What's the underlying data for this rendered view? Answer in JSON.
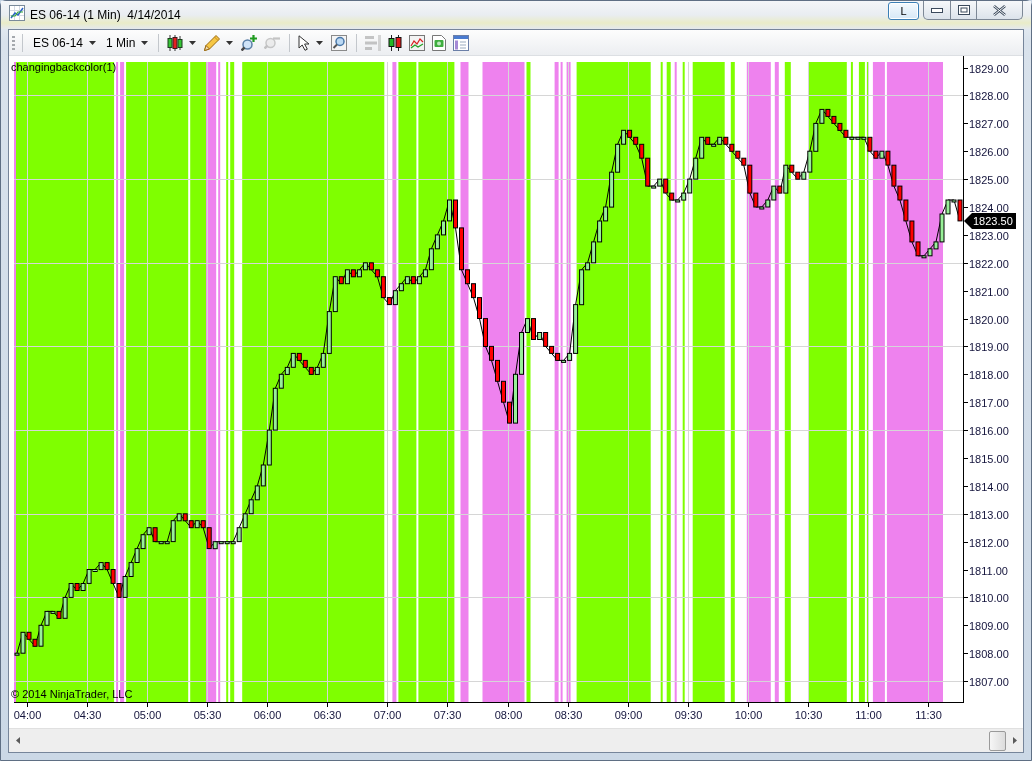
{
  "window": {
    "title": "ES 06-14 (1 Min)  4/14/2014",
    "buttons": [
      "L"
    ]
  },
  "toolbar": {
    "groups": [
      [
        {
          "kind": "select",
          "label": "ES 06-14",
          "disabled": false
        },
        {
          "kind": "select",
          "label": "1 Min",
          "disabled": false
        }
      ],
      [
        {
          "kind": "candles",
          "disabled": false
        },
        {
          "kind": "arrow",
          "disabled": false
        },
        {
          "kind": "pencil",
          "disabled": false
        },
        {
          "kind": "arrow",
          "disabled": false
        },
        {
          "kind": "zoomin",
          "disabled": false
        },
        {
          "kind": "zoomout",
          "disabled": true
        }
      ],
      [
        {
          "kind": "pointer",
          "disabled": false
        },
        {
          "kind": "arrow",
          "disabled": false
        },
        {
          "kind": "magnifier",
          "disabled": false
        }
      ],
      [
        {
          "kind": "rows",
          "disabled": true
        },
        {
          "kind": "candlebox",
          "disabled": false
        },
        {
          "kind": "linechart",
          "disabled": false
        },
        {
          "kind": "banknote",
          "disabled": false
        },
        {
          "kind": "layout",
          "disabled": false
        }
      ]
    ]
  },
  "chart": {
    "indicator_label": "changingbackcolor(1)",
    "copyright": "© 2014 NinjaTrader, LLC",
    "last_price": "1823.50",
    "chart_data": {
      "type": "line",
      "grid": true,
      "x": [
        235,
        238,
        241,
        244,
        247,
        250,
        253,
        256,
        259,
        262,
        265,
        268,
        271,
        274,
        277,
        280,
        283,
        286,
        289,
        292,
        295,
        298,
        301,
        304,
        307,
        310,
        313,
        316,
        319,
        322,
        325,
        328,
        331,
        334,
        337,
        340,
        343,
        346,
        349,
        352,
        355,
        358,
        361,
        364,
        367,
        370,
        373,
        376,
        379,
        382,
        385,
        388,
        391,
        394,
        397,
        400,
        403,
        406,
        409,
        412,
        415,
        418,
        421,
        424,
        427,
        430,
        433,
        436,
        439,
        442,
        445,
        448,
        451,
        454,
        457,
        460,
        463,
        466,
        469,
        472,
        475,
        478,
        481,
        484,
        487,
        490,
        493,
        496,
        499,
        502,
        505,
        508,
        511,
        514,
        517,
        520,
        523,
        526,
        529,
        532,
        535,
        538,
        541,
        544,
        547,
        550,
        553,
        556,
        559,
        562,
        565,
        568,
        571,
        574,
        577,
        580,
        583,
        586,
        589,
        592,
        595,
        598,
        601,
        604,
        607,
        610,
        613,
        616,
        619,
        622,
        625,
        628,
        631,
        634,
        637,
        640,
        643,
        646,
        649,
        652,
        655,
        658,
        661,
        664,
        667,
        670,
        673,
        676,
        679,
        682,
        685,
        688,
        691,
        694,
        697,
        700,
        703,
        706
      ],
      "values": [
        1808.0,
        1808.75,
        1808.5,
        1808.25,
        1809.0,
        1809.5,
        1809.5,
        1809.25,
        1810.0,
        1810.5,
        1810.25,
        1810.5,
        1811.0,
        1811.0,
        1811.25,
        1811.0,
        1810.5,
        1810.0,
        1810.75,
        1811.25,
        1811.75,
        1812.25,
        1812.5,
        1812.0,
        1812.0,
        1812.0,
        1812.75,
        1813.0,
        1812.75,
        1812.5,
        1812.75,
        1812.5,
        1811.75,
        1812.0,
        1812.0,
        1812.0,
        1812.0,
        1812.5,
        1813.0,
        1813.5,
        1814.0,
        1814.75,
        1816.0,
        1817.5,
        1818.0,
        1818.25,
        1818.75,
        1818.5,
        1818.25,
        1818.0,
        1818.25,
        1818.75,
        1820.25,
        1821.5,
        1821.25,
        1821.75,
        1821.5,
        1821.75,
        1822.0,
        1821.75,
        1821.5,
        1820.75,
        1820.5,
        1821.0,
        1821.25,
        1821.5,
        1821.25,
        1821.5,
        1821.75,
        1822.5,
        1823.0,
        1823.5,
        1824.25,
        1823.25,
        1821.75,
        1821.25,
        1820.75,
        1820.0,
        1819.0,
        1818.5,
        1817.75,
        1817.0,
        1816.25,
        1818.0,
        1819.5,
        1820.0,
        1819.25,
        1819.5,
        1819.0,
        1818.75,
        1818.5,
        1818.5,
        1818.75,
        1820.5,
        1821.75,
        1822.0,
        1822.75,
        1823.5,
        1824.0,
        1825.25,
        1826.25,
        1826.75,
        1826.5,
        1826.25,
        1825.75,
        1824.75,
        1824.75,
        1825.0,
        1824.5,
        1824.25,
        1824.25,
        1824.5,
        1825.0,
        1825.75,
        1826.5,
        1826.25,
        1826.25,
        1826.5,
        1826.25,
        1826.0,
        1825.75,
        1825.5,
        1824.5,
        1824.0,
        1824.0,
        1824.25,
        1824.75,
        1824.5,
        1825.5,
        1825.25,
        1825.0,
        1825.25,
        1826.0,
        1827.0,
        1827.5,
        1827.25,
        1827.0,
        1826.75,
        1826.5,
        1826.5,
        1826.5,
        1826.5,
        1826.0,
        1825.75,
        1826.0,
        1825.5,
        1824.75,
        1824.25,
        1823.5,
        1822.75,
        1822.25,
        1822.25,
        1822.5,
        1822.75,
        1823.75,
        1824.25,
        1824.25,
        1823.5
      ],
      "xlim": [
        233.5,
        707.5
      ],
      "ylim": [
        1806.25,
        1829.2
      ],
      "xticks": [
        {
          "value": 240,
          "label": "04:00"
        },
        {
          "value": 270,
          "label": "04:30"
        },
        {
          "value": 300,
          "label": "05:00"
        },
        {
          "value": 330,
          "label": "05:30"
        },
        {
          "value": 360,
          "label": "06:00"
        },
        {
          "value": 390,
          "label": "06:30"
        },
        {
          "value": 420,
          "label": "07:00"
        },
        {
          "value": 450,
          "label": "07:30"
        },
        {
          "value": 480,
          "label": "08:00"
        },
        {
          "value": 510,
          "label": "08:30"
        },
        {
          "value": 540,
          "label": "09:00"
        },
        {
          "value": 570,
          "label": "09:30"
        },
        {
          "value": 600,
          "label": "10:00"
        },
        {
          "value": 630,
          "label": "10:30"
        },
        {
          "value": 660,
          "label": "11:00"
        },
        {
          "value": 690,
          "label": "11:30"
        }
      ],
      "yticks": [
        {
          "value": 1807,
          "label": "1807.00"
        },
        {
          "value": 1808,
          "label": "1808.00"
        },
        {
          "value": 1809,
          "label": "1809.00"
        },
        {
          "value": 1810,
          "label": "1810.00"
        },
        {
          "value": 1811,
          "label": "1811.00"
        },
        {
          "value": 1812,
          "label": "1812.00"
        },
        {
          "value": 1813,
          "label": "1813.00"
        },
        {
          "value": 1814,
          "label": "1814.00"
        },
        {
          "value": 1815,
          "label": "1815.00"
        },
        {
          "value": 1816,
          "label": "1816.00"
        },
        {
          "value": 1817,
          "label": "1817.00"
        },
        {
          "value": 1818,
          "label": "1818.00"
        },
        {
          "value": 1819,
          "label": "1819.00"
        },
        {
          "value": 1820,
          "label": "1820.00"
        },
        {
          "value": 1821,
          "label": "1821.00"
        },
        {
          "value": 1822,
          "label": "1822.00"
        },
        {
          "value": 1823,
          "label": "1823.00"
        },
        {
          "value": 1824,
          "label": "1824.00"
        },
        {
          "value": 1825,
          "label": "1825.00"
        },
        {
          "value": 1826,
          "label": "1826.00"
        },
        {
          "value": 1827,
          "label": "1827.00"
        },
        {
          "value": 1828,
          "label": "1828.00"
        },
        {
          "value": 1829,
          "label": "1829.00"
        }
      ],
      "bands": [
        {
          "axis": "x",
          "from": 233.5,
          "to": 234.5,
          "color": "#ee82ee"
        },
        {
          "axis": "x",
          "from": 234.5,
          "to": 283.5,
          "color": "#7fff00"
        },
        {
          "axis": "x",
          "from": 284.5,
          "to": 285.5,
          "color": "#ee82ee"
        },
        {
          "axis": "x",
          "from": 286.5,
          "to": 288.5,
          "color": "#ee82ee"
        },
        {
          "axis": "x",
          "from": 289.5,
          "to": 320.5,
          "color": "#7fff00"
        },
        {
          "axis": "x",
          "from": 321.5,
          "to": 329.5,
          "color": "#7fff00"
        },
        {
          "axis": "x",
          "from": 329.5,
          "to": 334.5,
          "color": "#ee82ee"
        },
        {
          "axis": "x",
          "from": 335.5,
          "to": 336.5,
          "color": "#ee82ee"
        },
        {
          "axis": "x",
          "from": 339.5,
          "to": 340.5,
          "color": "#7fff00"
        },
        {
          "axis": "x",
          "from": 341.5,
          "to": 343.5,
          "color": "#7fff00"
        },
        {
          "axis": "x",
          "from": 347.5,
          "to": 418.5,
          "color": "#7fff00"
        },
        {
          "axis": "x",
          "from": 422.5,
          "to": 424.5,
          "color": "#ee82ee"
        },
        {
          "axis": "x",
          "from": 425.5,
          "to": 434.5,
          "color": "#7fff00"
        },
        {
          "axis": "x",
          "from": 435.5,
          "to": 453.5,
          "color": "#7fff00"
        },
        {
          "axis": "x",
          "from": 456.5,
          "to": 460.5,
          "color": "#ee82ee"
        },
        {
          "axis": "x",
          "from": 467.5,
          "to": 488.5,
          "color": "#ee82ee"
        },
        {
          "axis": "x",
          "from": 489.5,
          "to": 491.5,
          "color": "#7fff00"
        },
        {
          "axis": "x",
          "from": 503.5,
          "to": 505.5,
          "color": "#ee82ee"
        },
        {
          "axis": "x",
          "from": 506.5,
          "to": 507.5,
          "color": "#ee82ee"
        },
        {
          "axis": "x",
          "from": 509.5,
          "to": 511.5,
          "color": "#ee82ee"
        },
        {
          "axis": "x",
          "from": 514.5,
          "to": 551.5,
          "color": "#7fff00"
        },
        {
          "axis": "x",
          "from": 556.5,
          "to": 557.5,
          "color": "#7fff00"
        },
        {
          "axis": "x",
          "from": 559.5,
          "to": 561.5,
          "color": "#7fff00"
        },
        {
          "axis": "x",
          "from": 563.5,
          "to": 564.5,
          "color": "#ee82ee"
        },
        {
          "axis": "x",
          "from": 567.5,
          "to": 568.5,
          "color": "#7fff00"
        },
        {
          "axis": "x",
          "from": 572.5,
          "to": 588.5,
          "color": "#7fff00"
        },
        {
          "axis": "x",
          "from": 591.5,
          "to": 593.5,
          "color": "#7fff00"
        },
        {
          "axis": "x",
          "from": 599.5,
          "to": 611.5,
          "color": "#ee82ee"
        },
        {
          "axis": "x",
          "from": 613.5,
          "to": 615.5,
          "color": "#ee82ee"
        },
        {
          "axis": "x",
          "from": 618.5,
          "to": 621.5,
          "color": "#7fff00"
        },
        {
          "axis": "x",
          "from": 630.5,
          "to": 649.5,
          "color": "#7fff00"
        },
        {
          "axis": "x",
          "from": 651.5,
          "to": 652.5,
          "color": "#7fff00"
        },
        {
          "axis": "x",
          "from": 655.5,
          "to": 658.5,
          "color": "#7fff00"
        },
        {
          "axis": "x",
          "from": 659.5,
          "to": 660.5,
          "color": "#7fff00"
        },
        {
          "axis": "x",
          "from": 662.5,
          "to": 668.5,
          "color": "#ee82ee"
        },
        {
          "axis": "x",
          "from": 669.5,
          "to": 697.5,
          "color": "#ee82ee"
        }
      ]
    }
  }
}
